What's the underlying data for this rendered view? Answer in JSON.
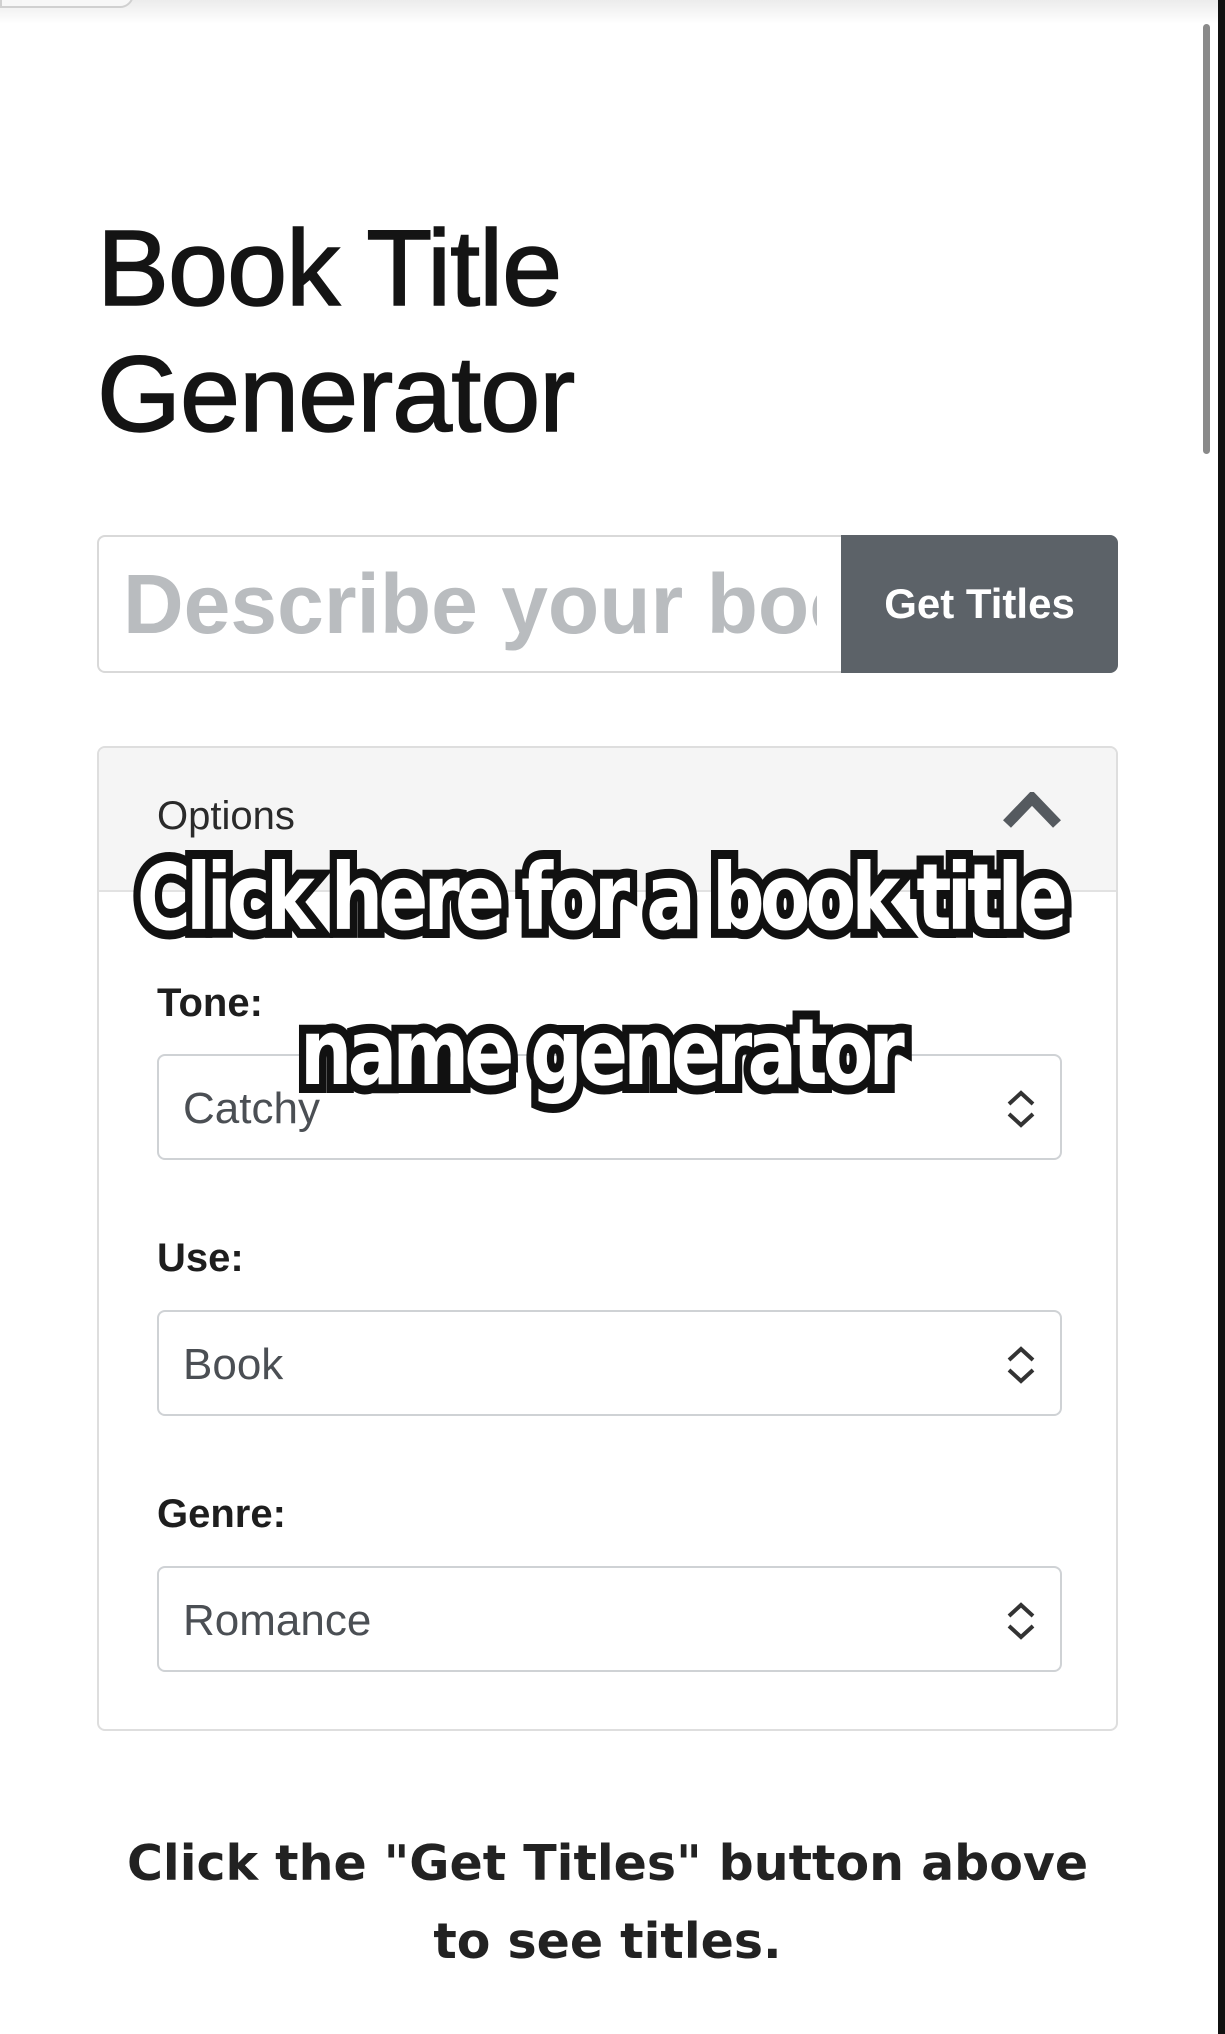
{
  "page": {
    "title": "Book Title Generator"
  },
  "search": {
    "placeholder": "Describe your book",
    "value": "",
    "button_label": "Get Titles"
  },
  "options": {
    "header_label": "Options",
    "header_icon": "chevron-up-icon",
    "expanded": true,
    "fields": [
      {
        "label": "Tone:",
        "value": "Catchy",
        "icon": "select-arrows-icon"
      },
      {
        "label": "Use:",
        "value": "Book",
        "icon": "select-arrows-icon"
      },
      {
        "label": "Genre:",
        "value": "Romance",
        "icon": "select-arrows-icon"
      }
    ]
  },
  "overlay_caption": "Click here for a book title name generator",
  "footer": {
    "message": "Click the \"Get Titles\" button above to see titles."
  },
  "colors": {
    "button_bg": "#5c6268",
    "button_text": "#ffffff",
    "header_bg": "#f5f5f5",
    "placeholder": "#b9bcbf"
  }
}
